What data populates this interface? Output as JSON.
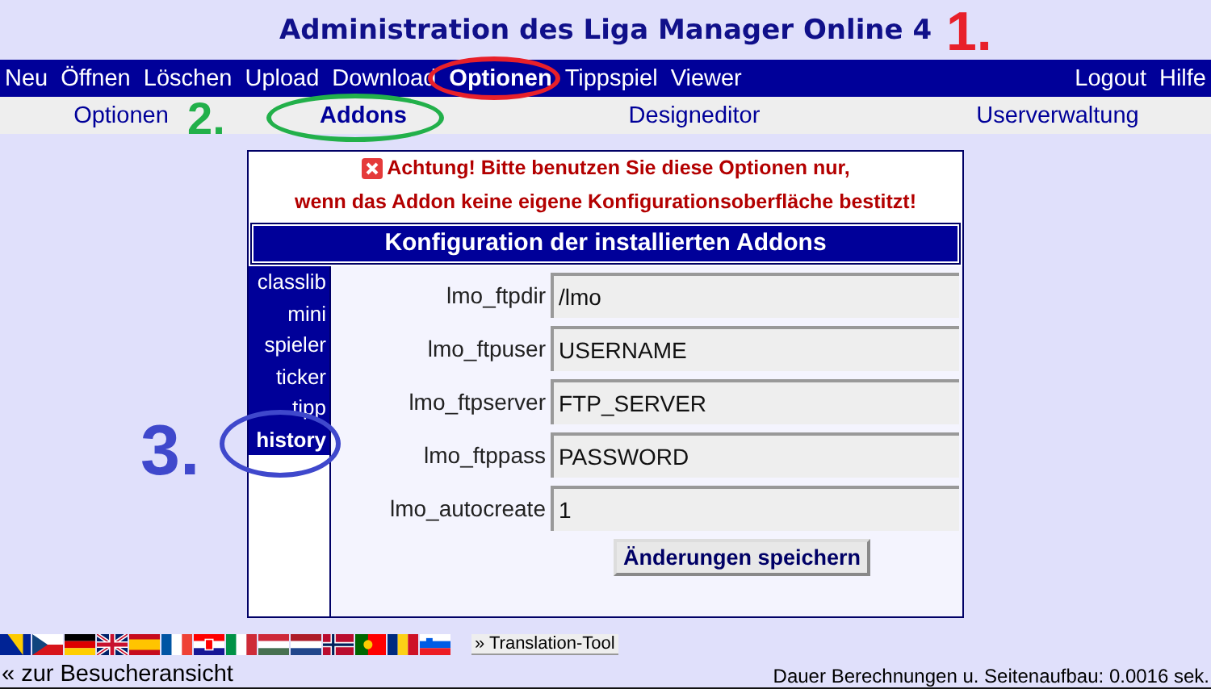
{
  "header": {
    "title": "Administration des Liga Manager Online 4"
  },
  "main_menu": {
    "left": [
      {
        "label": "Neu",
        "selected": false
      },
      {
        "label": "Öffnen",
        "selected": false
      },
      {
        "label": "Löschen",
        "selected": false
      },
      {
        "label": "Upload",
        "selected": false
      },
      {
        "label": "Download",
        "selected": false
      },
      {
        "label": "Optionen",
        "selected": true
      },
      {
        "label": "Tippspiel",
        "selected": false
      },
      {
        "label": "Viewer",
        "selected": false
      }
    ],
    "right": [
      {
        "label": "Logout"
      },
      {
        "label": "Hilfe"
      }
    ]
  },
  "sub_menu": [
    {
      "label": "Optionen",
      "selected": false
    },
    {
      "label": "Addons",
      "selected": true
    },
    {
      "label": "Designeditor",
      "selected": false
    },
    {
      "label": "Userverwaltung",
      "selected": false
    }
  ],
  "warning": {
    "lines": [
      "Achtung! Bitte benutzen Sie diese Optionen nur,",
      "wenn das Addon keine eigene Konfigurationsoberfläche bestitzt!"
    ]
  },
  "panel": {
    "title": "Konfiguration der installierten Addons",
    "addons": [
      {
        "label": "classlib",
        "selected": false
      },
      {
        "label": "mini",
        "selected": false
      },
      {
        "label": "spieler",
        "selected": false
      },
      {
        "label": "ticker",
        "selected": false
      },
      {
        "label": "tipp",
        "selected": false
      },
      {
        "label": "history",
        "selected": true
      }
    ],
    "fields": [
      {
        "label": "lmo_ftpdir",
        "value": "/lmo"
      },
      {
        "label": "lmo_ftpuser",
        "value": "USERNAME"
      },
      {
        "label": "lmo_ftpserver",
        "value": "FTP_SERVER"
      },
      {
        "label": "lmo_ftppass",
        "value": "PASSWORD"
      },
      {
        "label": "lmo_autocreate",
        "value": "1"
      }
    ],
    "save_button": "Änderungen speichern"
  },
  "annotations": [
    {
      "label": "1.",
      "color": "#e8202a"
    },
    {
      "label": "2.",
      "color": "#22b04a"
    },
    {
      "label": "3.",
      "color": "#3f48cc"
    }
  ],
  "flags": [
    {
      "kind": "ba"
    },
    {
      "kind": "cz"
    },
    {
      "kind": "de"
    },
    {
      "kind": "gb"
    },
    {
      "kind": "es"
    },
    {
      "kind": "fr"
    },
    {
      "kind": "hr"
    },
    {
      "kind": "it"
    },
    {
      "kind": "hu"
    },
    {
      "kind": "nl"
    },
    {
      "kind": "no"
    },
    {
      "kind": "pt"
    },
    {
      "kind": "ro"
    },
    {
      "kind": "si"
    }
  ],
  "translation_link": "» Translation-Tool",
  "footer": {
    "back_link": "« zur Besucheransicht",
    "timing": "Dauer Berechnungen u. Seitenaufbau: 0.0016 sek."
  }
}
